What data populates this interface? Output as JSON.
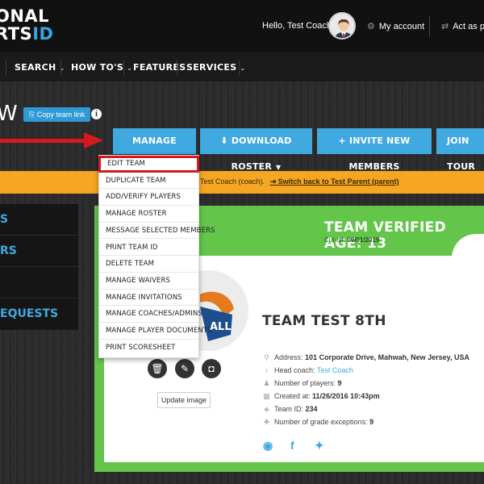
{
  "header": {
    "logo_line1": "ONAL",
    "logo_line2_prefix": "RTS",
    "logo_line2_id": "ID",
    "greeting": "Hello, Test Coach",
    "my_account": "My account",
    "act_as": "Act as par"
  },
  "nav": {
    "items": [
      {
        "label": "SEARCH"
      },
      {
        "label": "HOW TO'S"
      },
      {
        "label": "FEATURES"
      },
      {
        "label": "SERVICES"
      }
    ]
  },
  "page": {
    "title_fragment": "W",
    "copy_team_link": "Copy team link"
  },
  "actions": {
    "manage_team": "MANAGE TEAM",
    "download_roster": "DOWNLOAD ROSTER",
    "invite_new_members": "INVITE NEW MEMBERS",
    "join_tour": "JOIN TOUR"
  },
  "notice": {
    "text": "Test Coach (coach).",
    "switch_link": "Switch back to Test Parent (parent)"
  },
  "sidebar": {
    "items": [
      {
        "label": "S"
      },
      {
        "label": "RS"
      },
      {
        "label": ""
      },
      {
        "label": "EQUESTS"
      }
    ]
  },
  "team": {
    "verified_age": "TEAM VERIFIED AGE: 13",
    "cutoff_label": "Cut-off:",
    "cutoff_value": "09/01/2019",
    "logo_text": "ALL",
    "update_image": "Update image",
    "name": "TEAM TEST 8TH",
    "address_label": "Address:",
    "address_value": "101 Corporate Drive, Mahwah, New Jersey, USA",
    "head_coach_label": "Head coach:",
    "head_coach_value": "Test Coach",
    "players_label": "Number of players:",
    "players_value": "9",
    "created_label": "Created at:",
    "created_value": "11/26/2016 10:43pm",
    "team_id_label": "Team ID:",
    "team_id_value": "234",
    "grade_exceptions_label": "Number of grade exceptions:",
    "grade_exceptions_value": "9"
  },
  "menu": {
    "items": [
      {
        "label": "EDIT TEAM"
      },
      {
        "label": "DUPLICATE TEAM"
      },
      {
        "label": "ADD/VERIFY PLAYERS"
      },
      {
        "label": "MANAGE ROSTER"
      },
      {
        "label": "MESSAGE SELECTED MEMBERS"
      },
      {
        "label": "PRINT TEAM ID"
      },
      {
        "label": "DELETE TEAM"
      },
      {
        "label": "MANAGE WAIVERS"
      },
      {
        "label": "MANAGE INVITATIONS"
      },
      {
        "label": "MANAGE COACHES/ADMINS"
      },
      {
        "label": "MANAGE PLAYER DOCUMENTS"
      },
      {
        "label": "PRINT SCORESHEET"
      }
    ]
  },
  "colors": {
    "accent_blue": "#3fa9e0",
    "notice_orange": "#f5a623",
    "card_green": "#63c54a",
    "highlight_red": "#d7191f"
  },
  "icons": [
    "user-avatar",
    "gear-icon",
    "switch-icon",
    "copy-icon",
    "info-icon",
    "download-icon",
    "plus-icon",
    "trash-icon",
    "pencil-icon",
    "instagram-icon",
    "map-marker-icon",
    "whistle-icon",
    "users-icon",
    "calendar-icon",
    "tag-icon",
    "user-plus-icon",
    "globe-icon",
    "facebook-icon",
    "twitter-icon"
  ]
}
